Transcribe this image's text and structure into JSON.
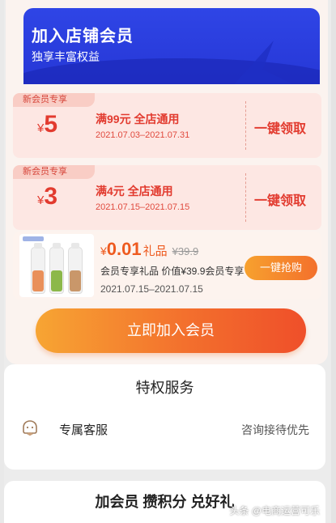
{
  "header": {
    "title": "加入店铺会员",
    "subtitle": "独享丰富权益"
  },
  "coupons": [
    {
      "tag": "新会员专享",
      "currency": "¥",
      "amount": "5",
      "condition": "满99元  全店通用",
      "dates": "2021.07.03–2021.07.31",
      "claim_label": "一键领取"
    },
    {
      "tag": "新会员专享",
      "currency": "¥",
      "amount": "3",
      "condition": "满4元  全店通用",
      "dates": "2021.07.15–2021.07.15",
      "claim_label": "一键领取"
    }
  ],
  "product": {
    "currency": "¥",
    "price": "0.01",
    "gift_label": "礼品",
    "original_price": "¥39.9",
    "description": "会员专享礼品  价值¥39.9会员专享",
    "dates": "2021.07.15–2021.07.15",
    "button_label": "一键抢购",
    "bottle_colors": [
      "#e9905a",
      "#8cb84a",
      "#c9976a"
    ]
  },
  "join_button": {
    "label": "立即加入会员"
  },
  "privileges": {
    "title": "特权服务",
    "items": [
      {
        "icon": "customer-service-icon",
        "label": "专属客服",
        "value": "咨询接待优先"
      }
    ]
  },
  "points": {
    "title": "加会员 攒积分 兑好礼"
  },
  "watermark": "头条 @电商运营可乐",
  "colors": {
    "brand_blue": "#2f45e6",
    "coupon_red": "#e23b2f",
    "orange": "#f3702c"
  }
}
